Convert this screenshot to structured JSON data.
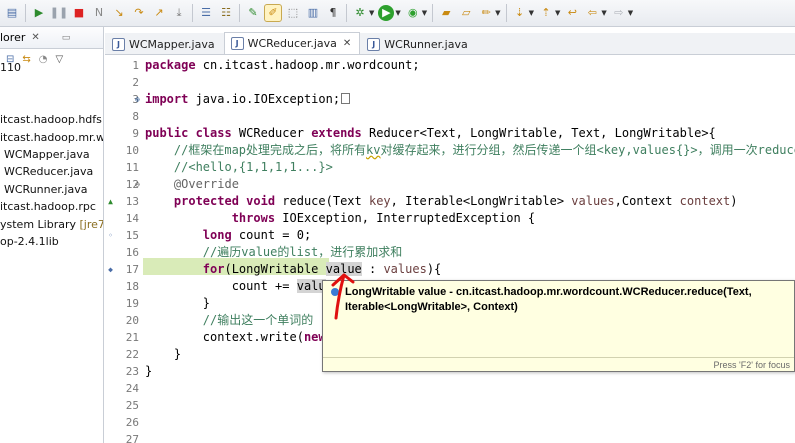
{
  "toolbar": {
    "icons": [
      "save-all-icon",
      "resume-icon",
      "suspend-icon",
      "terminate-icon",
      "disconnect-icon",
      "step-into-icon",
      "step-over-icon",
      "step-return-icon",
      "drop-to-frame-icon",
      "use-step-filters-icon",
      "toggle-mark-occurrences-icon",
      "toggle-breadcrumb-icon",
      "show-whitespace-icon",
      "debug-icon",
      "run-icon",
      "external-tools-icon",
      "open-type-icon",
      "open-task-icon",
      "search-icon",
      "next-annotation-icon",
      "prev-annotation-icon",
      "back-icon",
      "forward-icon"
    ]
  },
  "explorer": {
    "tab_label": "lorer",
    "items": [
      {
        "label": "110"
      },
      {
        "label": ""
      },
      {
        "label": ""
      },
      {
        "label": "itcast.hadoop.hdfs"
      },
      {
        "label": "itcast.hadoop.mr.w"
      },
      {
        "label": "WCMapper.java"
      },
      {
        "label": "WCReducer.java"
      },
      {
        "label": "WCRunner.java"
      },
      {
        "label": "itcast.hadoop.rpc"
      },
      {
        "label": "ystem Library",
        "decoration": "[jre7]"
      },
      {
        "label": "op-2.4.1lib"
      }
    ]
  },
  "tabs": [
    {
      "label": "WCMapper.java",
      "active": false
    },
    {
      "label": "WCReducer.java",
      "active": true
    },
    {
      "label": "WCRunner.java",
      "active": false
    }
  ],
  "editor": {
    "line_numbers": [
      "1",
      "2",
      "3",
      "8",
      "9",
      "10",
      "11",
      "12",
      "13",
      "14",
      "15",
      "16",
      "17",
      "18",
      "19",
      "20",
      "21",
      "22",
      "23",
      "24",
      "25",
      "26",
      "27"
    ],
    "lines": {
      "l1": "package cn.itcast.hadoop.mr.wordcount;",
      "l3a": "import",
      "l3b": " java.io.IOException;",
      "l9a": "public class",
      "l9b": " WCReducer ",
      "l9c": "extends",
      "l9d": " Reducer<Text, LongWritable, Text, LongWritable>{",
      "l10a": "    //框架在map处理完成之后，将所有",
      "l10b": "kv",
      "l10c": "对缓存起来，进行分组，然后传递一个组<key,values{}>，调用一次reduce方法",
      "l11": "    //<hello,{1,1,1,1...}>",
      "l12": "    @Override",
      "l13a": "    protected void",
      "l13b": " reduce(Text ",
      "l13c": "key",
      "l13d": ", Iterable<LongWritable> ",
      "l13e": "values",
      "l13f": ",Context ",
      "l13g": "context",
      "l13h": ")",
      "l14a": "            throws",
      "l14b": " IOException, InterruptedException {",
      "l15a": "        long",
      "l15b": " count = 0;",
      "l16": "        //遍历value的list，进行累加求和",
      "l17a": "        for",
      "l17b": "(LongWritable ",
      "l17c": "value",
      "l17d": " : ",
      "l17e": "values",
      "l17f": "){",
      "l18a": "            count += ",
      "l18b": "valu",
      "l19": "        }",
      "l20": "        //输出这一个单词的",
      "l21a": "        context.write(",
      "l21b": "new",
      "l22": "    }",
      "l23": "}"
    }
  },
  "popup": {
    "text": "LongWritable value - cn.itcast.hadoop.mr.wordcount.WCReducer.reduce(Text, Iterable<LongWritable>, Context)",
    "footer": "Press 'F2' for focus"
  },
  "colors": {
    "keyword": "#7f0055",
    "comment": "#3f7f5f",
    "highlight": "#d9ebb8",
    "popup_bg": "#ffffe1",
    "annotation_arrow": "#e01010"
  }
}
